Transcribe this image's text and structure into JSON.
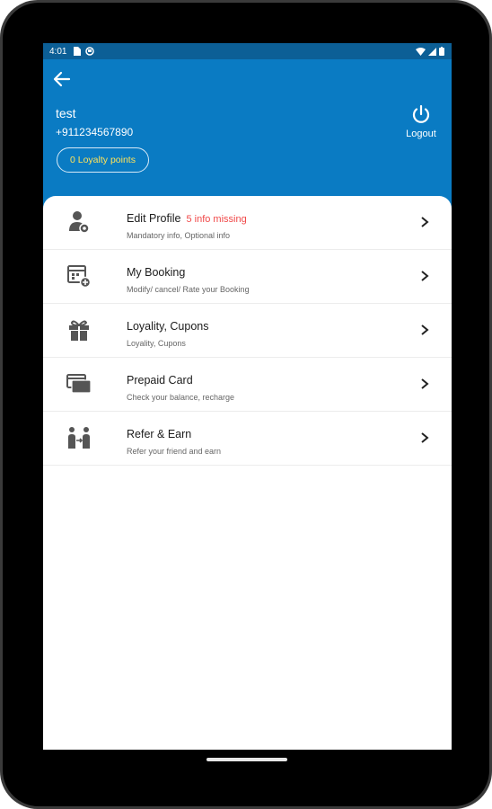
{
  "status_bar": {
    "time": "4:01",
    "left_icons": [
      "sim-card-icon",
      "notification-icon"
    ],
    "right_icons": [
      "wifi-icon",
      "signal-icon",
      "battery-icon"
    ]
  },
  "header": {
    "background_color": "#0a7bc3",
    "back_icon": "arrow-left-icon",
    "user_name": "test",
    "phone": "+911234567890",
    "loyalty_label": "0 Loyalty points",
    "loyalty_color": "#ffe35a",
    "logout_label": "Logout",
    "logout_icon": "power-icon"
  },
  "menu": {
    "items": [
      {
        "icon": "user-gear-icon",
        "title": "Edit Profile",
        "badge": "5 info missing",
        "subtitle": "Mandatory info, Optional info"
      },
      {
        "icon": "calendar-add-icon",
        "title": "My Booking",
        "badge": "",
        "subtitle": "Modify/ cancel/ Rate your Booking"
      },
      {
        "icon": "gift-icon",
        "title": "Loyality, Cupons",
        "badge": "",
        "subtitle": "Loyality, Cupons"
      },
      {
        "icon": "credit-card-icon",
        "title": "Prepaid Card",
        "badge": "",
        "subtitle": "Check your balance, recharge"
      },
      {
        "icon": "refer-people-icon",
        "title": "Refer & Earn",
        "badge": "",
        "subtitle": "Refer your friend and earn"
      }
    ],
    "badge_color": "#f04848"
  }
}
